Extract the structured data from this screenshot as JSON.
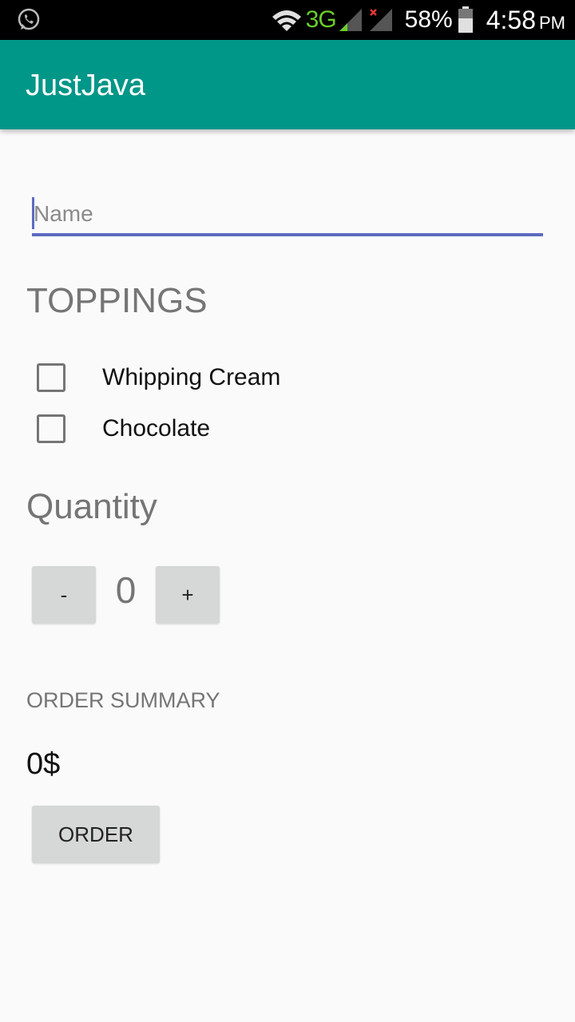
{
  "status_bar": {
    "network_type": "3G",
    "battery": "58%",
    "time": "4:58",
    "ampm": "PM",
    "icons": [
      "whatsapp-icon",
      "wifi-icon",
      "signal-icon",
      "signal-no-sim-icon",
      "battery-icon"
    ]
  },
  "app_bar": {
    "title": "JustJava",
    "color": "#009688"
  },
  "form": {
    "name_value": "",
    "name_placeholder": "Name",
    "accent": "#5c6bc0"
  },
  "toppings": {
    "heading": "TOPPINGS",
    "items": [
      {
        "label": "Whipping Cream",
        "checked": false
      },
      {
        "label": "Chocolate",
        "checked": false
      }
    ]
  },
  "quantity": {
    "heading": "Quantity",
    "decrement_label": "-",
    "value": "0",
    "increment_label": "+"
  },
  "summary": {
    "heading": "ORDER SUMMARY",
    "price": "0$",
    "order_label": "ORDER"
  }
}
